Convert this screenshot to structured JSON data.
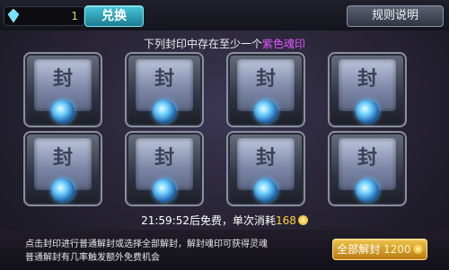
{
  "currency": {
    "amount": "1",
    "icon": "diamond-icon"
  },
  "buttons": {
    "exchange": "兑换",
    "rules": "规则说明",
    "unseal_all": "全部解封",
    "unseal_all_price": "1200"
  },
  "notice": {
    "prefix": "下列封印中存在至少一个",
    "highlight": "紫色魂印",
    "highlight_color": "#e357ff"
  },
  "seals": [
    {
      "char": "封"
    },
    {
      "char": "封"
    },
    {
      "char": "封"
    },
    {
      "char": "封"
    },
    {
      "char": "封"
    },
    {
      "char": "封"
    },
    {
      "char": "封"
    },
    {
      "char": "封"
    }
  ],
  "timer": {
    "time": "21:59:52",
    "text": "后免费，单次消耗",
    "cost": "168"
  },
  "tip": {
    "line1": "点击封印进行普通解封或选择全部解封，解封魂印可获得灵魂",
    "line2": "普通解封有几率触发额外免费机会"
  }
}
